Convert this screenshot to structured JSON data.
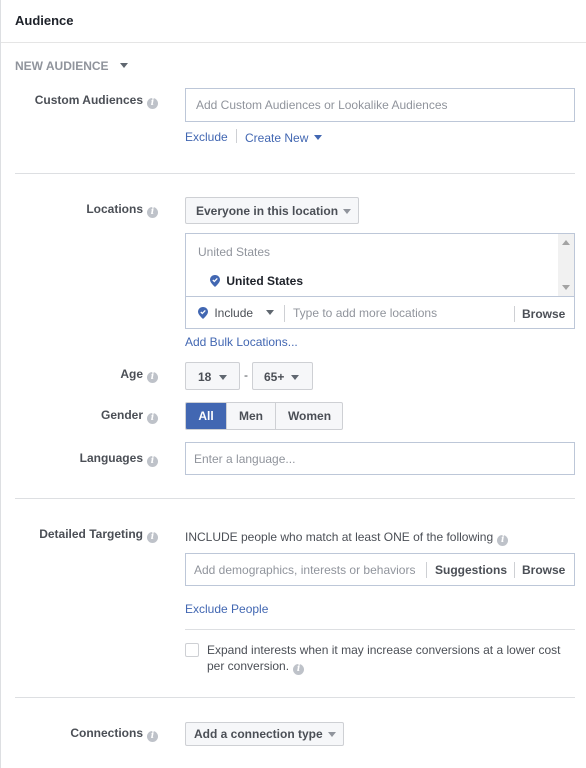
{
  "header": {
    "title": "Audience"
  },
  "audience_selector": {
    "label": "NEW AUDIENCE"
  },
  "custom_audiences": {
    "label": "Custom Audiences",
    "placeholder": "Add Custom Audiences or Lookalike Audiences",
    "exclude_link": "Exclude",
    "create_new_link": "Create New"
  },
  "locations": {
    "label": "Locations",
    "scope_dropdown": "Everyone in this location",
    "group_header": "United States",
    "selected_items": [
      "United States"
    ],
    "include_dropdown": "Include",
    "search_placeholder": "Type to add more locations",
    "browse_label": "Browse",
    "bulk_link": "Add Bulk Locations..."
  },
  "age": {
    "label": "Age",
    "min": "18",
    "separator": "-",
    "max": "65+"
  },
  "gender": {
    "label": "Gender",
    "options": [
      "All",
      "Men",
      "Women"
    ],
    "selected": "All"
  },
  "languages": {
    "label": "Languages",
    "placeholder": "Enter a language..."
  },
  "detailed_targeting": {
    "label": "Detailed Targeting",
    "include_text": "INCLUDE people who match at least ONE of the following",
    "placeholder": "Add demographics, interests or behaviors",
    "suggestions_label": "Suggestions",
    "browse_label": "Browse",
    "exclude_link": "Exclude People",
    "expand_checkbox_label": "Expand interests when it may increase conversions at a lower cost per conversion.",
    "expand_checked": false
  },
  "connections": {
    "label": "Connections",
    "dropdown": "Add a connection type"
  },
  "colors": {
    "accent": "#4267b2",
    "label_text": "#4b4f56",
    "placeholder": "#90949c",
    "border": "#bdc7d8"
  }
}
